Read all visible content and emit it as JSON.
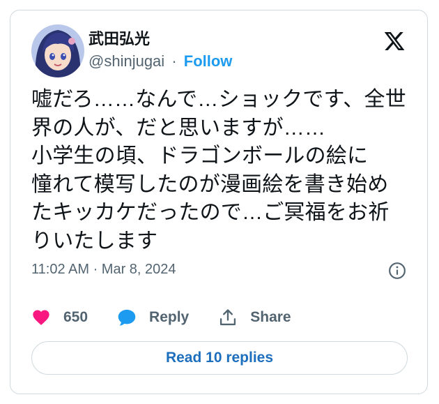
{
  "author": {
    "name": "武田弘光",
    "handle": "@shinjugai",
    "separator": "·",
    "follow_label": "Follow"
  },
  "icons": {
    "avatar": "avatar-image",
    "brand": "x-logo-icon",
    "info": "info-icon",
    "like": "heart-icon",
    "reply": "speech-bubble-icon",
    "share": "share-upload-icon"
  },
  "tweet": {
    "lines": [
      "嘘だろ……なんで…ショックです、全世",
      "界の人が、だと思いますが……",
      "小学生の頃、ドラゴンボールの絵に",
      "憧れて模写したのが漫画絵を書き始め",
      "たキッカケだったので…ご冥福をお祈",
      "りいたします"
    ],
    "timestamp": "11:02 AM · Mar 8, 2024"
  },
  "actions": {
    "likes_count": "650",
    "reply_label": "Reply",
    "share_label": "Share"
  },
  "read_replies_label": "Read 10 replies",
  "colors": {
    "accent": "#1d9bf0",
    "like": "#f91880",
    "muted": "#536471",
    "border": "#cfd9de"
  }
}
